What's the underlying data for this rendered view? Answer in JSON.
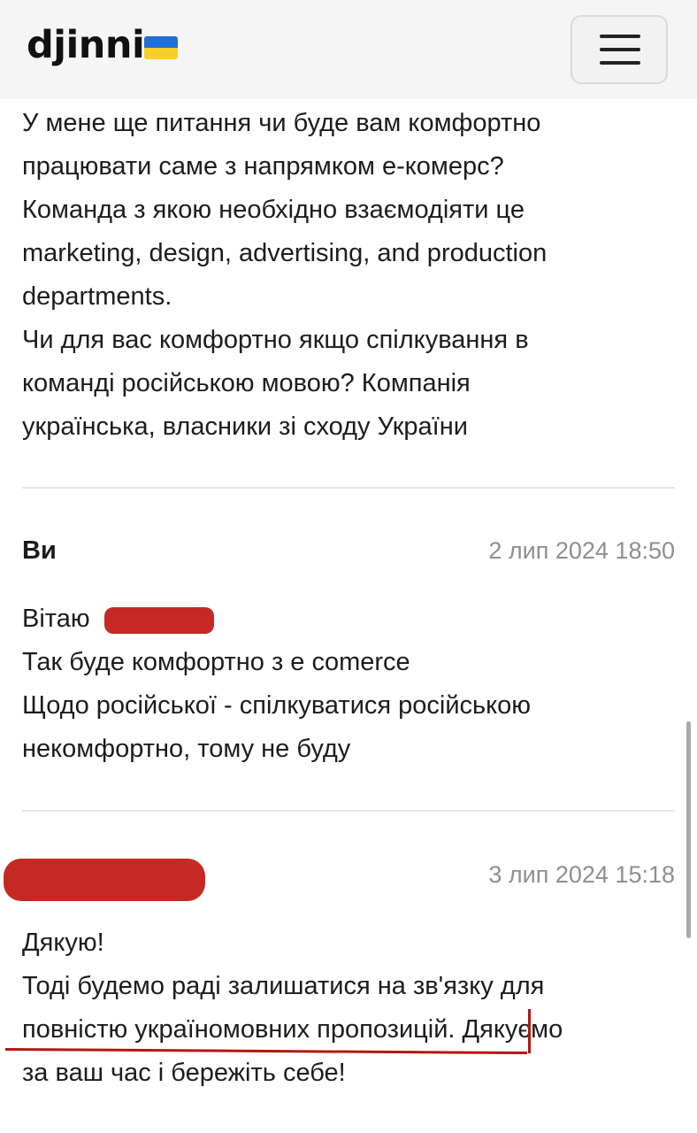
{
  "header": {
    "logo_text": "djinni",
    "flag_colors": [
      "#1f6fd6",
      "#f7cf2a"
    ],
    "menu_icon": "hamburger-menu-icon"
  },
  "messages": [
    {
      "lines": [
        "У мене ще питання чи буде вам комфортно",
        "працювати саме з напрямком е-комерс?",
        "Команда з якою необхідно взаємодіяти це",
        "marketing, design, advertising, and production",
        "departments.",
        "Чи для вас комфортно якщо спілкування в",
        "команді російською мовою? Компанія",
        "українська, власники зі сходу України"
      ]
    },
    {
      "author": "Ви",
      "timestamp": "2 лип 2024 18:50",
      "lines": [
        "Вітаю",
        "Так буде комфортно з е comerce",
        "Щодо російської - спілкуватися російською",
        "некомфортно, тому не буду"
      ]
    },
    {
      "author": "",
      "timestamp": "3 лип 2024 15:18",
      "lines": [
        "Дякую!",
        "Тоді будемо раді залишатися на зв'язку для",
        "повністю україномовних пропозицій. Дякуємо",
        "за ваш час і бережіть себе!"
      ]
    }
  ],
  "colors": {
    "redaction": "#c01a12",
    "timestamp": "#8e8e93",
    "topbar_bg": "#f5f5f5"
  }
}
